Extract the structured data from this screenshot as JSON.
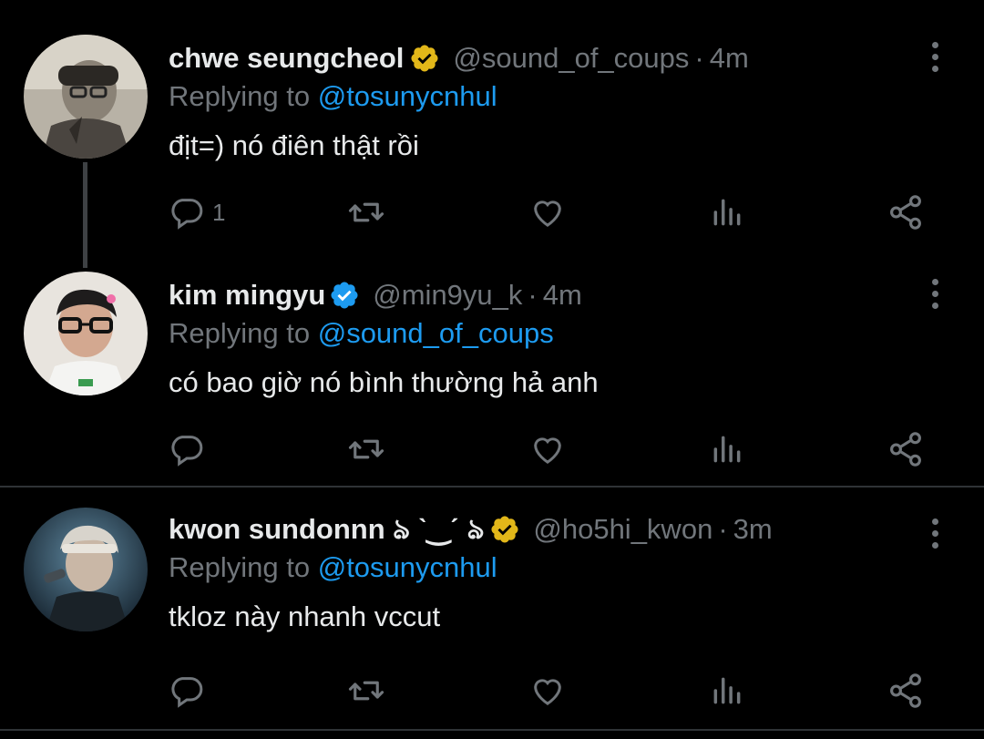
{
  "tweets": [
    {
      "name": "chwe seungcheol",
      "badge": "gold",
      "handle": "@sound_of_coups",
      "dot": "·",
      "time": "4m",
      "replying_prefix": "Replying to",
      "replying_to": "@tosunycnhul",
      "text": "địt=) nó điên thật rồi",
      "reply_count": "1",
      "avatar_icon": "avatar-photo-grayscale"
    },
    {
      "name": "kim mingyu",
      "badge": "blue",
      "handle": "@min9yu_k",
      "dot": "·",
      "time": "4m",
      "replying_prefix": "Replying to",
      "replying_to": "@sound_of_coups",
      "text": "có bao giờ nó bình thường hả anh",
      "reply_count": "",
      "avatar_icon": "avatar-photo-glasses"
    },
    {
      "name": "kwon sundonnn ঌ ˋ‿ˊ ঌ",
      "badge": "gold",
      "handle": "@ho5hi_kwon",
      "dot": "·",
      "time": "3m",
      "replying_prefix": "Replying to",
      "replying_to": "@tosunycnhul",
      "text": "tkloz này nhanh vccut",
      "reply_count": "",
      "avatar_icon": "avatar-photo-stage"
    }
  ],
  "colors": {
    "background": "#000000",
    "text": "#e7e9ea",
    "muted": "#71767b",
    "link": "#1d9bf0",
    "gold_badge": "#e2b719",
    "blue_badge": "#1d9bf0",
    "divider": "#2f3336"
  },
  "icons": [
    "reply-icon",
    "retweet-icon",
    "like-icon",
    "views-icon",
    "share-icon",
    "more-icon",
    "verified-badge-icon"
  ]
}
